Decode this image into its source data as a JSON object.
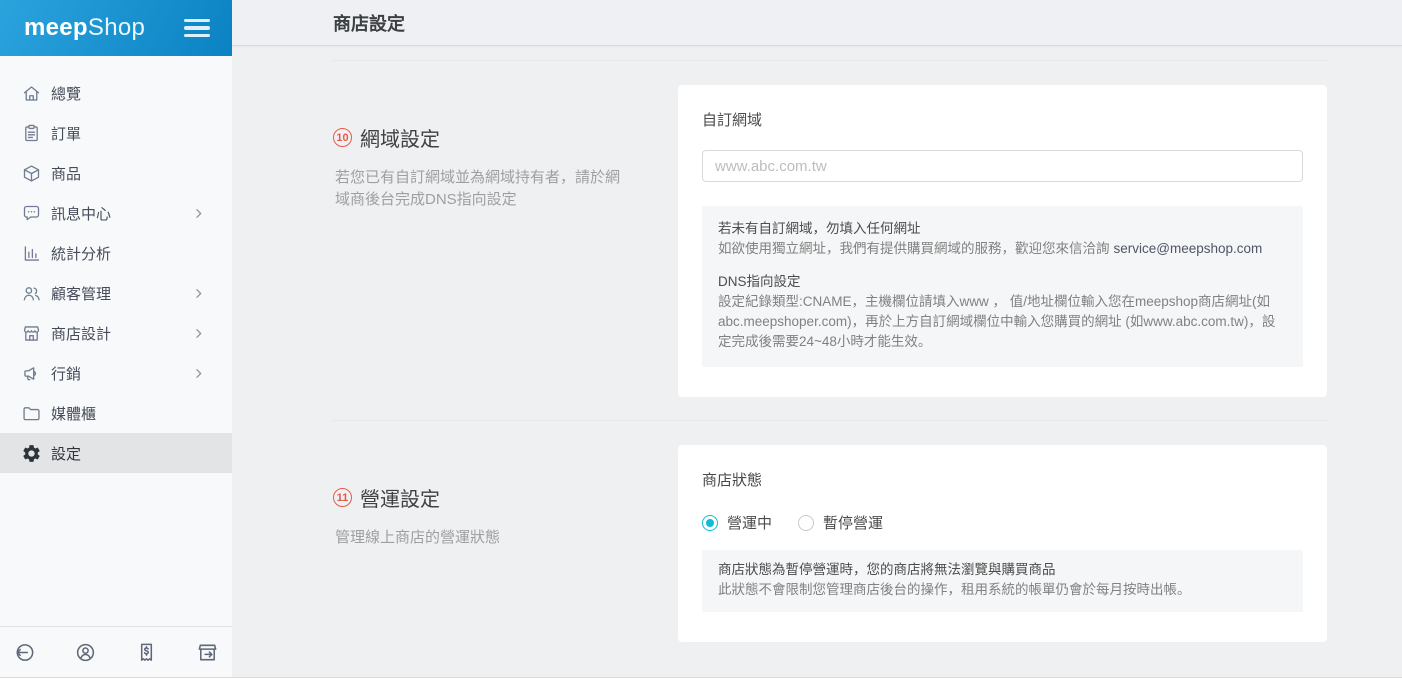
{
  "brand": {
    "logo_bold": "meep",
    "logo_light": "Shop"
  },
  "header": {
    "title": "商店設定"
  },
  "sidebar": {
    "items": [
      {
        "label": "總覽",
        "icon": "home-icon",
        "has_submenu": false,
        "active": false
      },
      {
        "label": "訂單",
        "icon": "orders-icon",
        "has_submenu": false,
        "active": false
      },
      {
        "label": "商品",
        "icon": "products-icon",
        "has_submenu": false,
        "active": false
      },
      {
        "label": "訊息中心",
        "icon": "messages-icon",
        "has_submenu": true,
        "active": false
      },
      {
        "label": "統計分析",
        "icon": "analytics-icon",
        "has_submenu": false,
        "active": false
      },
      {
        "label": "顧客管理",
        "icon": "customers-icon",
        "has_submenu": true,
        "active": false
      },
      {
        "label": "商店設計",
        "icon": "store-design-icon",
        "has_submenu": true,
        "active": false
      },
      {
        "label": "行銷",
        "icon": "marketing-icon",
        "has_submenu": true,
        "active": false
      },
      {
        "label": "媒體櫃",
        "icon": "media-icon",
        "has_submenu": false,
        "active": false
      },
      {
        "label": "設定",
        "icon": "settings-icon",
        "has_submenu": false,
        "active": true
      }
    ],
    "footer_icons": [
      "logout-icon",
      "account-icon",
      "billing-icon",
      "visit-store-icon"
    ]
  },
  "sections": {
    "domain": {
      "number": "10",
      "title": "網域設定",
      "description": "若您已有自訂網域並為網域持有者，請於網域商後台完成DNS指向設定",
      "field_label": "自訂網域",
      "input_placeholder": "www.abc.com.tw",
      "note_heading": "若未有自訂網域，勿填入任何網址",
      "note_line": "如欲使用獨立網址，我們有提供購買網域的服務，歡迎您來信洽詢",
      "note_email": "service@meepshop.com",
      "dns_heading": "DNS指向設定",
      "dns_text": "設定紀錄類型:CNAME，主機欄位請填入www ， 值/地址欄位輸入您在meepshop商店網址(如abc.meepshoper.com)，再於上方自訂網域欄位中輸入您購買的網址 (如www.abc.com.tw)，設定完成後需要24~48小時才能生效。"
    },
    "operation": {
      "number": "11",
      "title": "營運設定",
      "description": "管理線上商店的營運狀態",
      "field_label": "商店狀態",
      "radio_active": "營運中",
      "radio_paused": "暫停營運",
      "selected_radio": "營運中",
      "note_heading": "商店狀態為暫停營運時，您的商店將無法瀏覽與購買商品",
      "note_line": "此狀態不會限制您管理商店後台的操作，租用系統的帳單仍會於每月按時出帳。"
    }
  },
  "colors": {
    "sidebar_header_blue": "#0b82c3",
    "accent_cyan": "#10bdd3",
    "badge_red": "#e8594a",
    "content_bg": "#eff0f2",
    "active_item_bg": "#e3e4e6"
  }
}
